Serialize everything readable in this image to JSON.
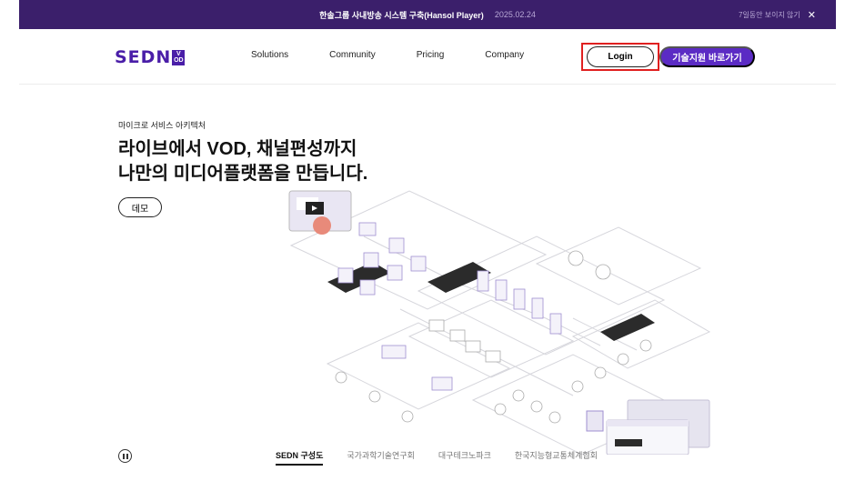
{
  "banner": {
    "text": "한솔그룹 사내방송 시스템 구축(Hansol Player)",
    "date": "2025.02.24",
    "hide_label": "7일동안 보이지 않기",
    "close_icon": "close-icon"
  },
  "header": {
    "logo_text": "SEDN",
    "logo_badge_top": "V",
    "logo_badge_bottom": "OD",
    "nav": [
      "Solutions",
      "Community",
      "Pricing",
      "Company"
    ],
    "login_label": "Login",
    "support_label": "기술지원 바로가기"
  },
  "hero": {
    "eyebrow": "마이크로 서비스 아키텍처",
    "headline_line1": "라이브에서 VOD, 채널편성까지",
    "headline_line2": "나만의 미디어플랫폼을 만듭니다.",
    "demo_label": "데모"
  },
  "tabs": {
    "items": [
      "SEDN 구성도",
      "국가과학기술연구회",
      "대구테크노파크",
      "한국지능형교통체계협회"
    ],
    "active_index": 0
  },
  "colors": {
    "brand": "#4a1ea8",
    "banner_bg": "#3b1f6b",
    "support_bg": "#5b2bc4",
    "highlight": "#e02020"
  }
}
